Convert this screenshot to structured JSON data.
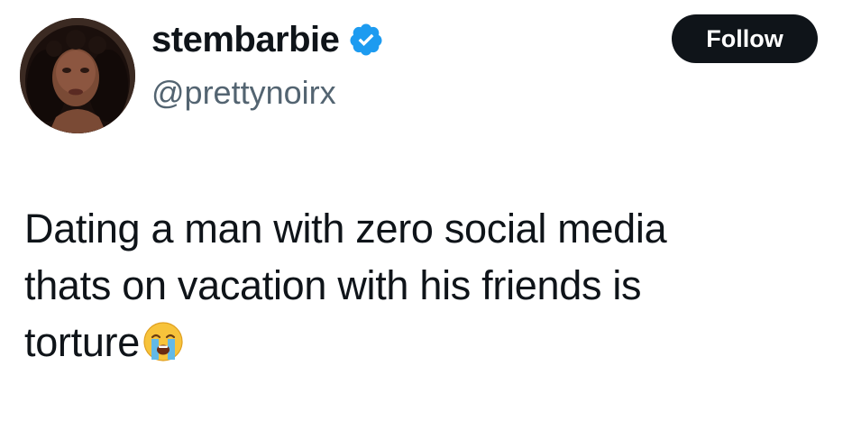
{
  "user": {
    "display_name": "stembarbie",
    "handle": "@prettynoirx",
    "verified": true,
    "verified_color": "#1d9bf0",
    "avatar_icon": "profile-photo"
  },
  "follow_button": {
    "label": "Follow",
    "background": "#0f1419",
    "text_color": "#ffffff"
  },
  "tweet": {
    "lines": [
      "Dating a man with zero social media",
      "thats on vacation with his friends is",
      "torture"
    ],
    "trailing_emoji": "loudly-crying-face"
  }
}
